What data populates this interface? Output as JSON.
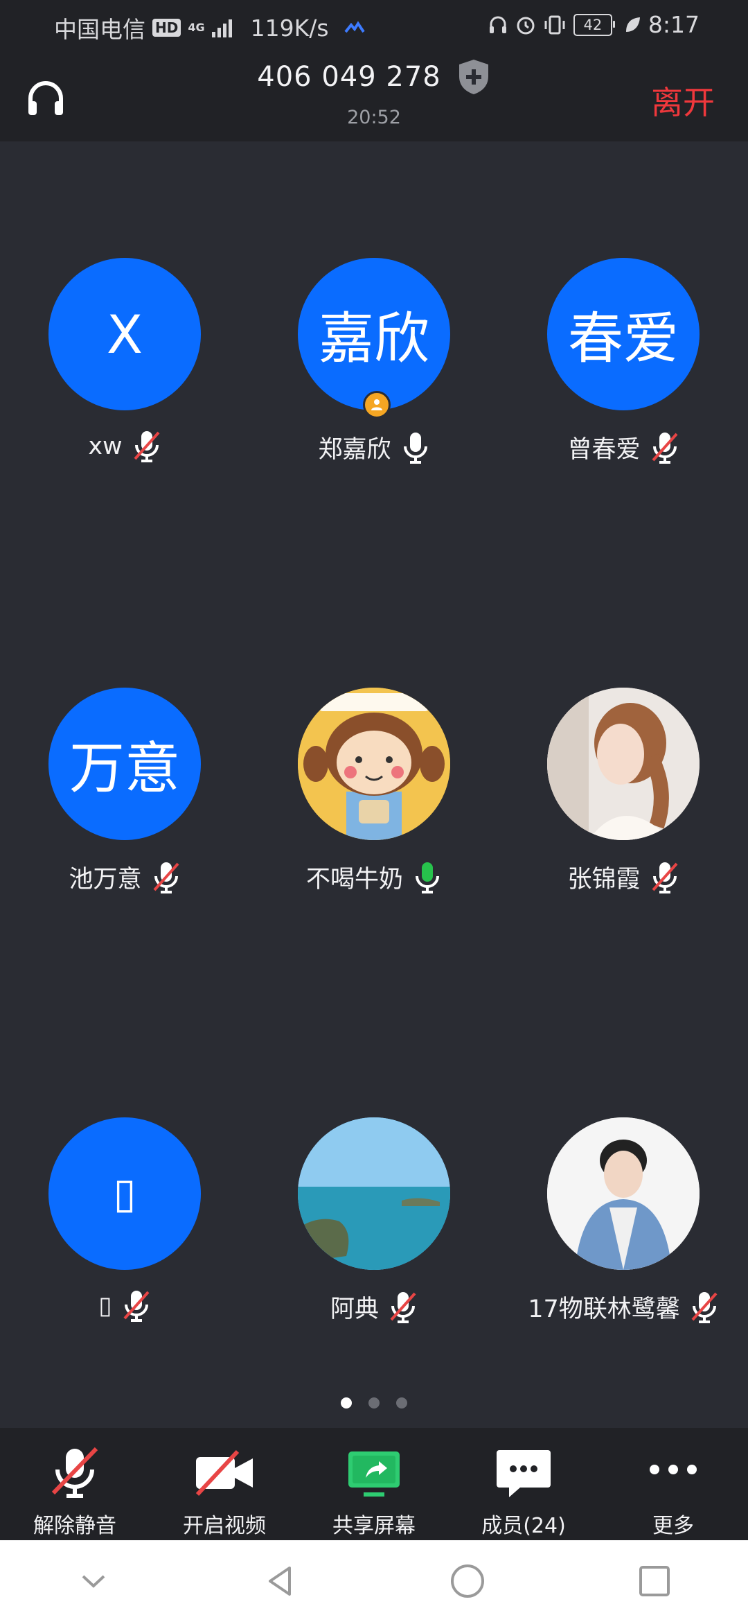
{
  "status_bar": {
    "carrier": "中国电信",
    "hd": "HD",
    "network": "4G",
    "speed": "119K/s",
    "battery": "42",
    "time": "8:17"
  },
  "header": {
    "meeting_id": "406 049 278",
    "duration": "20:52",
    "leave_label": "离开"
  },
  "participants": [
    {
      "name": "xw",
      "avatar_text": "X",
      "mic": "muted",
      "host": false
    },
    {
      "name": "郑嘉欣",
      "avatar_text": "嘉欣",
      "mic": "on",
      "host": true
    },
    {
      "name": "曾春爱",
      "avatar_text": "春爱",
      "mic": "muted",
      "host": false
    },
    {
      "name": "池万意",
      "avatar_text": "万意",
      "mic": "muted",
      "host": false
    },
    {
      "name": "不喝牛奶",
      "avatar_text": "",
      "mic": "speaking",
      "host": false,
      "avatar_image": "cartoon-girl"
    },
    {
      "name": "张锦霞",
      "avatar_text": "",
      "mic": "muted",
      "host": false,
      "avatar_image": "woman-photo"
    },
    {
      "name": "▯",
      "avatar_text": "▯",
      "mic": "muted",
      "host": false
    },
    {
      "name": "阿典",
      "avatar_text": "",
      "mic": "muted",
      "host": false,
      "avatar_image": "sea-landscape"
    },
    {
      "name": "17物联林鹭馨",
      "avatar_text": "",
      "mic": "muted",
      "host": false,
      "avatar_image": "man-photo"
    }
  ],
  "pagination": {
    "pages": 3,
    "current": 1
  },
  "toolbar": {
    "unmute": "解除静音",
    "video": "开启视频",
    "share": "共享屏幕",
    "members": "成员(24)",
    "more": "更多"
  },
  "colors": {
    "avatar_blue": "#0a6cff",
    "leave_red": "#f0383c",
    "mic_green": "#27c24c",
    "share_green": "#2ecc71",
    "host_orange": "#f5a623"
  }
}
